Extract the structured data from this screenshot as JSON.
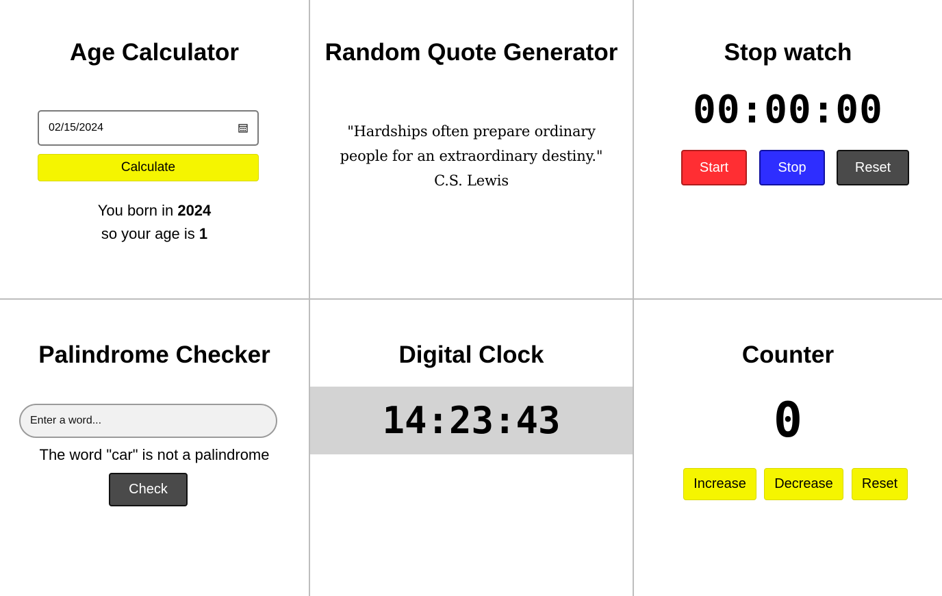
{
  "age_calculator": {
    "title": "Age Calculator",
    "date_value": "02/15/2024",
    "calculate_label": "Calculate",
    "result_prefix": "You born in ",
    "born_year": "2024",
    "result_middle": "so your age is ",
    "age": "1"
  },
  "quote_generator": {
    "title": "Random Quote Generator",
    "quote": "\"Hardships often prepare ordinary people for an extraordinary destiny.\" C.S. Lewis"
  },
  "stopwatch": {
    "title": "Stop watch",
    "time": "00:00:00",
    "start_label": "Start",
    "stop_label": "Stop",
    "reset_label": "Reset"
  },
  "palindrome": {
    "title": "Palindrome Checker",
    "placeholder": "Enter a word...",
    "result": "The word \"car\" is not a palindrome",
    "check_label": "Check"
  },
  "digital_clock": {
    "title": "Digital Clock",
    "time": "14:23:43"
  },
  "counter": {
    "title": "Counter",
    "value": "0",
    "increase_label": "Increase",
    "decrease_label": "Decrease",
    "reset_label": "Reset"
  },
  "colors": {
    "yellow": "#f5f500",
    "red": "#ff2e33",
    "blue": "#2e2eff",
    "dark": "#4a4a4a",
    "clock_band": "#d3d3d3"
  },
  "icons": [
    "calendar-icon"
  ]
}
